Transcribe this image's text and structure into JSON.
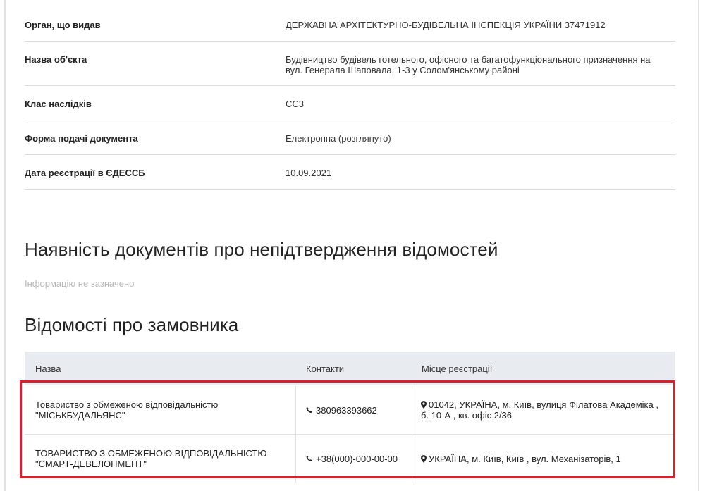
{
  "details": [
    {
      "label": "Орган, що видав",
      "value": "ДЕРЖАВНА АРХІТЕКТУРНО-БУДІВЕЛЬНА ІНСПЕКЦІЯ УКРАЇНИ 37471912"
    },
    {
      "label": "Назва об'єкта",
      "value_line1": "Будівництво будівель готельного, офісного та багатофункціонального призначення на",
      "value_line2": "вул. Генерала Шаповала, 1-3 у Солом'янському районі"
    },
    {
      "label": "Клас наслідків",
      "value": "СС3"
    },
    {
      "label": "Форма подачі документа",
      "value": "Електронна (розглянуто)"
    },
    {
      "label": "Дата реєстрації в ЄДЕССБ",
      "value": "10.09.2021"
    }
  ],
  "documents_section": {
    "title": "Наявність документів про непідтвердження відомостей",
    "empty_note": "Інформацію не зазначено"
  },
  "customer_section": {
    "title": "Відомості про замовника",
    "columns": [
      "Назва",
      "Контакти",
      "Місце реєстрації"
    ],
    "rows": [
      {
        "name_line1": "Товариство з обмеженою відповідальністю",
        "name_line2": "\"МІСЬКБУДАЛЬЯНС\"",
        "phone": "380963393662",
        "address_line1": "01042, УКРАЇНА, м. Київ, вулиця Філатова Академіка ,",
        "address_line2": "б. 10-А , кв. офіс 2/36"
      },
      {
        "name_line1": "ТОВАРИСТВО З ОБМЕЖЕНОЮ ВІДПОВІДАЛЬНІСТЮ",
        "name_line2": "\"СМАРТ-ДЕВЕЛОПМЕНТ\"",
        "phone": "+38(000)-000-00-00",
        "address_line1": "УКРАЇНА, м. Київ, Київ , вул. Механізаторів, 1",
        "address_line2": ""
      }
    ]
  },
  "icons": {
    "phone": "phone-icon",
    "location": "map-marker-icon"
  },
  "colors": {
    "highlight": "#d9202c",
    "table_header": "#e8ebef",
    "muted_text": "#b9b9b9"
  }
}
